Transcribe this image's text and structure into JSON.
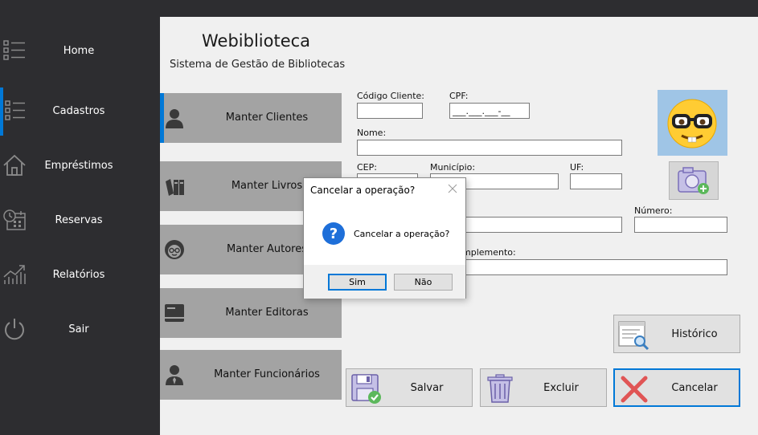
{
  "sidebar": {
    "items": [
      {
        "label": "Home",
        "icon": "list-icon"
      },
      {
        "label": "Cadastros",
        "icon": "list-icon"
      },
      {
        "label": "Empréstimos",
        "icon": "house-icon"
      },
      {
        "label": "Reservas",
        "icon": "calendar-clock-icon"
      },
      {
        "label": "Relatórios",
        "icon": "chart-icon"
      },
      {
        "label": "Sair",
        "icon": "power-icon"
      }
    ],
    "active_index": 1,
    "accent": "#0078d7"
  },
  "header": {
    "title": "Webiblioteca",
    "subtitle": "Sistema de Gestão de Bibliotecas"
  },
  "menu": {
    "items": [
      {
        "label": "Manter Clientes",
        "icon": "person-icon"
      },
      {
        "label": "Manter Livros",
        "icon": "books-icon"
      },
      {
        "label": "Manter Autores",
        "icon": "author-icon"
      },
      {
        "label": "Manter Editoras",
        "icon": "book-icon"
      },
      {
        "label": "Manter Funcionários",
        "icon": "employee-icon"
      }
    ]
  },
  "form": {
    "codigo_label": "Código Cliente:",
    "codigo_value": "",
    "cpf_label": "CPF:",
    "cpf_value": "___.___.___-__",
    "nome_label": "Nome:",
    "nome_value": "",
    "cep_label": "CEP:",
    "cep_value": "",
    "municipio_label": "Município:",
    "municipio_value": "",
    "uf_label": "UF:",
    "uf_value": "",
    "logradouro_value": "",
    "numero_label": "Número:",
    "numero_value": "",
    "complemento_label": "mplemento:",
    "complemento_value": ""
  },
  "photo": {
    "icon": "nerd-face-emoji"
  },
  "buttons": {
    "historico": "Histórico",
    "salvar": "Salvar",
    "excluir": "Excluir",
    "cancelar": "Cancelar"
  },
  "dialog": {
    "title": "Cancelar a operação?",
    "message": "Cancelar a operação?",
    "yes": "Sim",
    "no": "Não",
    "icon": "question-icon"
  }
}
